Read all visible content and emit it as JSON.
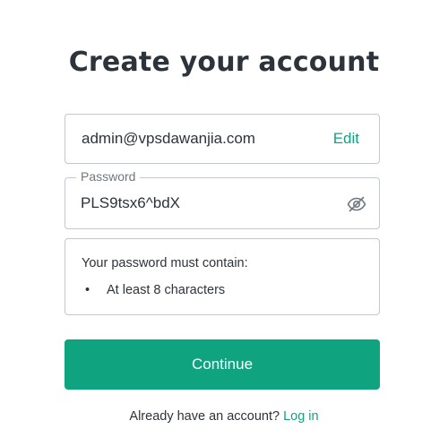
{
  "page_title": "Create your account",
  "email": {
    "value": "admin@vpsdawanjia.com",
    "edit_label": "Edit"
  },
  "password": {
    "label": "Password",
    "value": "PLS9tsx6^bdX",
    "toggle_icon": "eye-slash-icon"
  },
  "requirements": {
    "heading": "Your password must contain:",
    "items": [
      {
        "bullet": "•",
        "text": "At least 8 characters"
      }
    ]
  },
  "continue_label": "Continue",
  "footer": {
    "prompt": "Already have an account?",
    "login_label": "Log in"
  },
  "colors": {
    "accent": "#10a37f",
    "text": "#2d333a",
    "border": "#c2c8d0",
    "muted": "#6f7780"
  }
}
